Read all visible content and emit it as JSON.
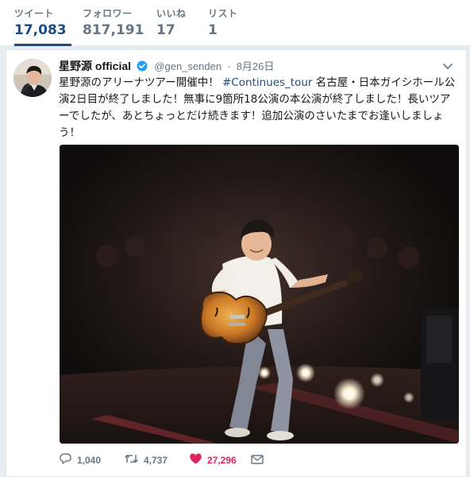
{
  "stats": [
    {
      "label": "ツイート",
      "value": "17,083"
    },
    {
      "label": "フォロワー",
      "value": "817,191"
    },
    {
      "label": "いいね",
      "value": "17"
    },
    {
      "label": "リスト",
      "value": "1"
    }
  ],
  "tweet": {
    "author_name": "星野源 official",
    "handle": "@gen_senden",
    "separator": "·",
    "date": "8月26日",
    "text_before": "星野源のアリーナツアー開催中！",
    "hashtag": "#Continues_tour",
    "text_after": "名古屋・日本ガイシホール公演2日目が終了しました！無事に9箇所18公演の本公演が終了しました！長いツアーでしたが、あとちょっとだけ続きます！追加公演のさいたまでお逢いしましょう！",
    "counts": {
      "replies": "1,040",
      "retweets": "4,737",
      "likes": "27,296"
    }
  },
  "colors": {
    "accent": "#1c4e85",
    "like": "#e0245e",
    "muted": "#657786",
    "verified": "#1da1f2"
  },
  "icons": {
    "verified": "verified-badge-icon",
    "caret": "chevron-down-icon",
    "reply": "reply-icon",
    "retweet": "retweet-icon",
    "like": "heart-icon",
    "message": "envelope-icon"
  }
}
